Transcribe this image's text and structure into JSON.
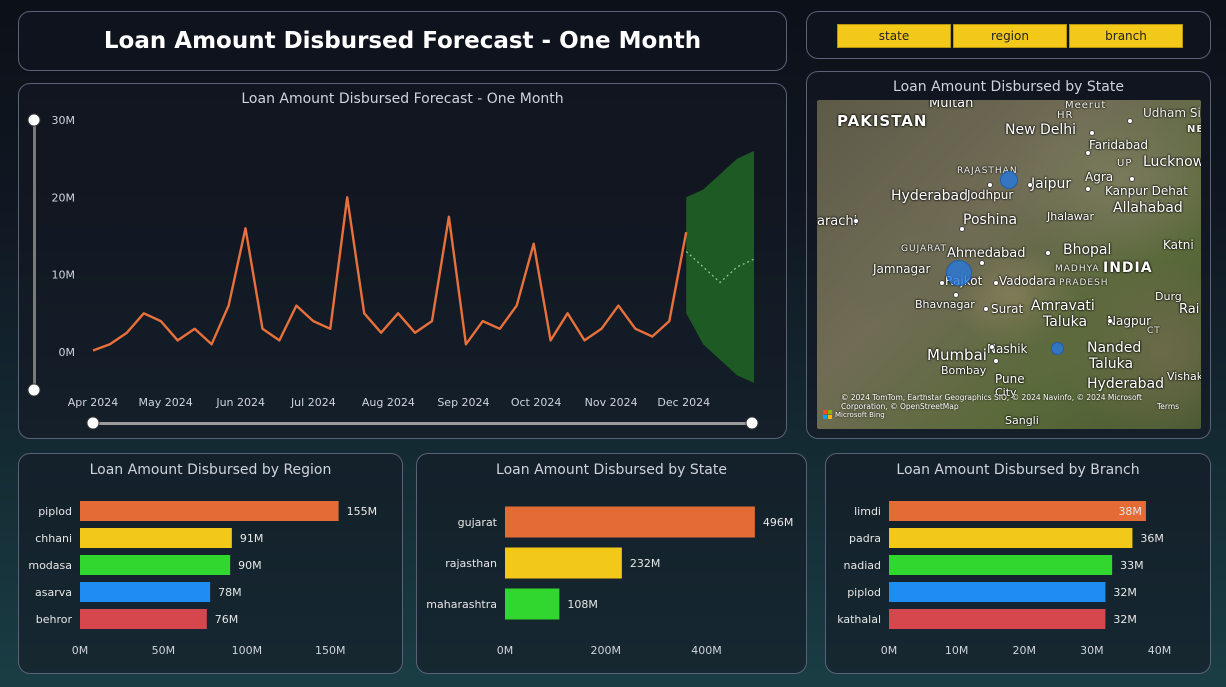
{
  "header": {
    "title": "Loan Amount Disbursed Forecast - One Month"
  },
  "slicers": [
    {
      "label": "state"
    },
    {
      "label": "region"
    },
    {
      "label": "branch"
    }
  ],
  "forecast": {
    "title": "Loan Amount Disbursed Forecast - One Month",
    "y_ticks": [
      "30M",
      "20M",
      "10M",
      "0M"
    ],
    "x_ticks": [
      "Apr 2024",
      "May 2024",
      "Jun 2024",
      "Jul 2024",
      "Aug 2024",
      "Sep 2024",
      "Oct 2024",
      "Nov 2024",
      "Dec 2024"
    ],
    "colors": {
      "actual": "#e8703a",
      "forecast_band": "#1e5a24",
      "forecast_line": "#8fd08a"
    }
  },
  "map": {
    "title": "Loan Amount Disbursed by State",
    "labels": {
      "multan": "Multan",
      "meerut": "Meerut",
      "udham": "Udham Sing",
      "pakistan": "PAKISTAN",
      "hr": "HR",
      "new_delhi": "New Delhi",
      "faridabad": "Faridabad",
      "up": "UP",
      "lucknow": "Lucknow",
      "rajasthan": "RAJASTHAN",
      "jaipur": "Jaipur",
      "agra": "Agra",
      "hyderabad_pk": "Hyderabad",
      "jodhpur": "Jodhpur",
      "kanpur": "Kanpur Dehat",
      "allahabad": "Allahabad",
      "karachi": "arachi",
      "poshina": "Poshina",
      "jhalawar": "Jhalawar",
      "gujarat": "GUJARAT",
      "ahmedabad": "Ahmedabad",
      "bhopal": "Bhopal",
      "katni": "Katni",
      "jamnagar": "Jamnagar",
      "madhya": "MADHYA",
      "india": "INDIA",
      "rajkot": "Rajkot",
      "vadodara": "Vadodara",
      "pradesh": "PRADESH",
      "bhavnagar": "Bhavnagar",
      "surat": "Surat",
      "amravati": "Amravati",
      "durg": "Durg",
      "taluka": "Taluka",
      "nagpur": "Nagpur",
      "rai": "Rai",
      "mumbai": "Mumbai",
      "nashik": "Nashik",
      "nanded": "Nanded",
      "ct": "CT",
      "bombay": "Bombay",
      "taluka2": "Taluka",
      "visakh": "Vishak",
      "pune": "Pune",
      "hyderabad_in": "Hyderabad",
      "pune_city": "City",
      "sangli": "Sangli",
      "ne": "NE"
    },
    "credit": "© 2024 TomTom, Earthstar Geographics SIO, © 2024 Navinfo, © 2024 Microsoft Corporation, © OpenStreetMap",
    "terms": "Terms",
    "bing": "Microsoft Bing"
  },
  "region_chart": {
    "title": "Loan Amount Disbursed by Region"
  },
  "state_chart": {
    "title": "Loan Amount Disbursed by State"
  },
  "branch_chart": {
    "title": "Loan Amount Disbursed by Branch"
  },
  "chart_data": [
    {
      "type": "line",
      "title": "Loan Amount Disbursed Forecast - One Month",
      "xlabel": "",
      "ylabel": "",
      "ylim": [
        0,
        30
      ],
      "y_unit": "M",
      "x_start": "2024-04-01",
      "x": [
        "2024-04-01",
        "2024-04-08",
        "2024-04-15",
        "2024-04-22",
        "2024-04-29",
        "2024-05-06",
        "2024-05-13",
        "2024-05-20",
        "2024-05-27",
        "2024-06-03",
        "2024-06-10",
        "2024-06-17",
        "2024-06-24",
        "2024-07-01",
        "2024-07-08",
        "2024-07-15",
        "2024-07-22",
        "2024-07-29",
        "2024-08-05",
        "2024-08-12",
        "2024-08-19",
        "2024-08-26",
        "2024-09-02",
        "2024-09-09",
        "2024-09-16",
        "2024-09-23",
        "2024-09-30",
        "2024-10-07",
        "2024-10-14",
        "2024-10-21",
        "2024-10-28",
        "2024-11-04",
        "2024-11-11",
        "2024-11-18",
        "2024-11-25",
        "2024-12-02"
      ],
      "series": [
        {
          "values": [
            0.2,
            1,
            2.5,
            5,
            4,
            1.5,
            3,
            1,
            6,
            16,
            3,
            1.5,
            6,
            4,
            3,
            20,
            5,
            2.5,
            5,
            2.5,
            4,
            17.5,
            1,
            4,
            3,
            6,
            14,
            1.5,
            5,
            1.5,
            3,
            6,
            3,
            2,
            4,
            15.5
          ]
        }
      ],
      "forecast": {
        "x": [
          "2024-12-02",
          "2024-12-09",
          "2024-12-16",
          "2024-12-23",
          "2024-12-30"
        ],
        "mean": [
          13,
          11,
          9,
          11,
          12
        ],
        "lower": [
          5,
          1,
          -1,
          -3,
          -4
        ],
        "upper": [
          20,
          21,
          23,
          25,
          26
        ]
      }
    },
    {
      "type": "bar",
      "title": "Loan Amount Disbursed by Region",
      "categories": [
        "piplod",
        "chhani",
        "modasa",
        "asarva",
        "behror"
      ],
      "values": [
        155,
        91,
        90,
        78,
        76
      ],
      "labels": [
        "155M",
        "91M",
        "90M",
        "78M",
        "76M"
      ],
      "colors": [
        "#e46b35",
        "#f2c919",
        "#31d62e",
        "#1e8cf3",
        "#d6474d"
      ],
      "ticks": [
        "0M",
        "50M",
        "100M",
        "150M"
      ],
      "xlim": [
        0,
        175
      ]
    },
    {
      "type": "bar",
      "title": "Loan Amount Disbursed by State",
      "categories": [
        "gujarat",
        "rajasthan",
        "maharashtra"
      ],
      "values": [
        496,
        232,
        108
      ],
      "labels": [
        "496M",
        "232M",
        "108M"
      ],
      "colors": [
        "#e46b35",
        "#f2c919",
        "#31d62e"
      ],
      "ticks": [
        "0M",
        "200M",
        "400M"
      ],
      "xlim": [
        0,
        540
      ]
    },
    {
      "type": "bar",
      "title": "Loan Amount Disbursed by Branch",
      "categories": [
        "limdi",
        "padra",
        "nadiad",
        "piplod",
        "kathalal"
      ],
      "values": [
        38,
        36,
        33,
        32,
        32
      ],
      "labels": [
        "38M",
        "36M",
        "33M",
        "32M",
        "32M"
      ],
      "colors": [
        "#e46b35",
        "#f2c919",
        "#31d62e",
        "#1e8cf3",
        "#d6474d"
      ],
      "ticks": [
        "0M",
        "10M",
        "20M",
        "30M",
        "40M"
      ],
      "xlim": [
        0,
        42
      ]
    }
  ]
}
